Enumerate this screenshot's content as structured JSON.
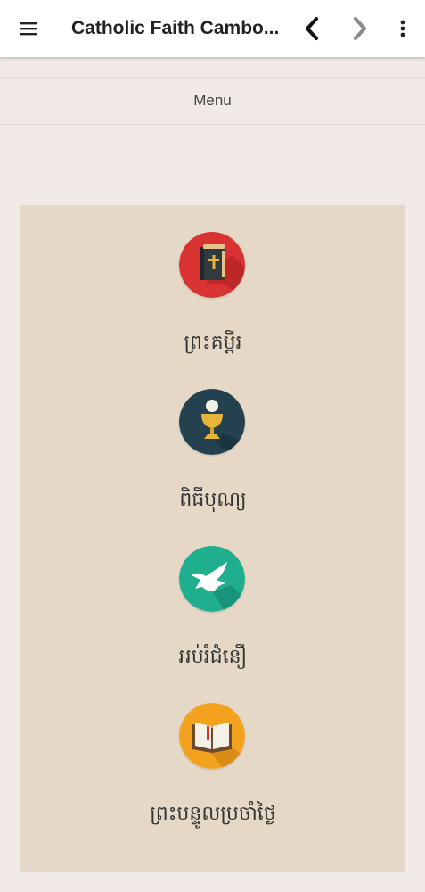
{
  "appbar": {
    "title": "Catholic Faith Cambo...",
    "icons": [
      "menu-icon",
      "back-icon",
      "forward-icon",
      "more-vert-icon"
    ]
  },
  "menu_header": "Menu",
  "menu_items": [
    {
      "label": "ព្រះគម្ពីរ",
      "icon": "bible-icon",
      "color": "#d93232"
    },
    {
      "label": "ពិធីបុណ្យ",
      "icon": "chalice-icon",
      "color": "#24414f"
    },
    {
      "label": "អប់រំជំនឿ",
      "icon": "dove-icon",
      "color": "#1fae8e"
    },
    {
      "label": "ព្រះបន្ទូលប្រចាំថ្ងៃ",
      "icon": "open-book-icon",
      "color": "#f2a21e"
    }
  ],
  "colors": {
    "background": "#f1e9e5",
    "panel": "#e5d8c6",
    "appbar": "#ffffff"
  }
}
